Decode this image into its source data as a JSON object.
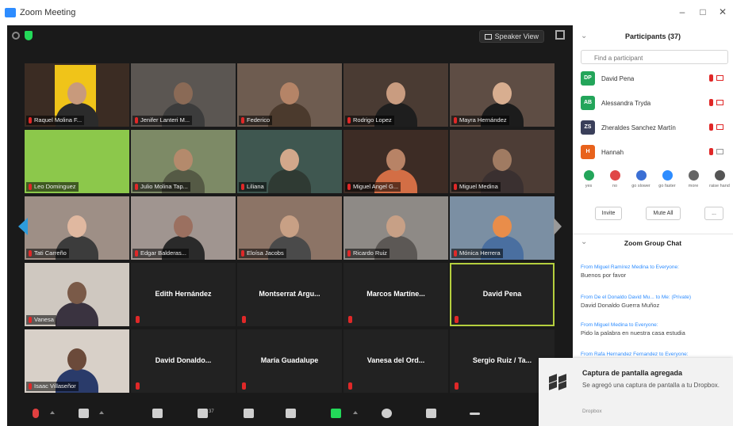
{
  "window": {
    "title": "Zoom Meeting",
    "controls": [
      "–",
      "□",
      "✕"
    ]
  },
  "meeting": {
    "speaker_view_label": "Speaker View",
    "tiles": [
      {
        "name": "Raquel Molina F...",
        "type": "video",
        "bg": "#3b2c23",
        "face": "#c89a7c",
        "shirt": "#2b2b2b",
        "accent": "#f0c419"
      },
      {
        "name": "Jenifer Lanteri M...",
        "type": "video",
        "bg": "#5b5652",
        "face": "#8a6a56",
        "shirt": "#3c3c3c",
        "accent": ""
      },
      {
        "name": "Federico",
        "type": "video",
        "bg": "#6e5c50",
        "face": "#b58467",
        "shirt": "#4b3a2d",
        "accent": ""
      },
      {
        "name": "Rodrigo Lopez",
        "type": "video",
        "bg": "#4a3b33",
        "face": "#c99c80",
        "shirt": "#1e1e1e",
        "accent": ""
      },
      {
        "name": "Mayra Hernández",
        "type": "video",
        "bg": "#5e4d44",
        "face": "#d8ae90",
        "shirt": "#1c1c1c",
        "accent": ""
      },
      {
        "name": "Leo Dominguez",
        "type": "video",
        "bg": "#8cc84b",
        "face": "",
        "shirt": "",
        "accent": ""
      },
      {
        "name": "Julio Molina Tap...",
        "type": "video",
        "bg": "#7d8a66",
        "face": "#b48a6c",
        "shirt": "#555a45",
        "accent": ""
      },
      {
        "name": "Liliana",
        "type": "video",
        "bg": "#3f5750",
        "face": "#d2a88b",
        "shirt": "#2f3a33",
        "accent": ""
      },
      {
        "name": "Miguel Angel G...",
        "type": "video",
        "bg": "#3d2c25",
        "face": "#b88366",
        "shirt": "#d36e45",
        "accent": ""
      },
      {
        "name": "Miguel Medina",
        "type": "video",
        "bg": "#4d3d36",
        "face": "#a07b62",
        "shirt": "#3a3030",
        "accent": ""
      },
      {
        "name": "Tati Carreño",
        "type": "video",
        "bg": "#9e8f86",
        "face": "#e0b8a0",
        "shirt": "#3c3c3c",
        "accent": ""
      },
      {
        "name": "Edgar Balderas...",
        "type": "video",
        "bg": "#a09590",
        "face": "#9b7060",
        "shirt": "#2a2a2a",
        "accent": ""
      },
      {
        "name": "Eloísa Jacobs",
        "type": "video",
        "bg": "#8c7466",
        "face": "#c8a085",
        "shirt": "#4a4a4a",
        "accent": ""
      },
      {
        "name": "Ricardo Ruiz",
        "type": "video",
        "bg": "#8e8a86",
        "face": "#c7a086",
        "shirt": "#5c5855",
        "accent": ""
      },
      {
        "name": "Mónica Herrera",
        "type": "video",
        "bg": "#7b8fa3",
        "face": "#e98d4a",
        "shirt": "#4a6fa0",
        "accent": ""
      },
      {
        "name": "Vanesa",
        "type": "video",
        "bg": "#cfc8c0",
        "face": "#7a5a48",
        "shirt": "#3a3340",
        "accent": ""
      },
      {
        "name": "Edith Hernández",
        "type": "name"
      },
      {
        "name": "Montserrat Argu...",
        "type": "name"
      },
      {
        "name": "Marcos Martíne...",
        "type": "name"
      },
      {
        "name": "David Pena",
        "type": "name",
        "active": true
      },
      {
        "name": "Isaac Villaseñor",
        "type": "video",
        "bg": "#d8d0c8",
        "face": "#6b4a3a",
        "shirt": "#2a3b6a",
        "accent": ""
      },
      {
        "name": "David Donaldo...",
        "type": "name"
      },
      {
        "name": "María Guadalupe",
        "type": "name"
      },
      {
        "name": "Vanesa del Ord...",
        "type": "name"
      },
      {
        "name": "Sergio Ruiz / Ta...",
        "type": "name"
      }
    ]
  },
  "toolbar": {
    "participant_count": "37",
    "items": [
      "unmute",
      "video",
      "security",
      "participants",
      "polls",
      "chat",
      "share",
      "record",
      "reactions",
      "more"
    ]
  },
  "panel": {
    "title": "Participants (37)",
    "search_placeholder": "Find a participant",
    "participants": [
      {
        "name": "David Pena",
        "initials": "DP",
        "color": "#23a55a"
      },
      {
        "name": "Alessandra Tryda",
        "initials": "AB",
        "color": "#23a55a"
      },
      {
        "name": "Zheraldes Sanchez Martín",
        "initials": "ZS",
        "color": "#3a3f5a"
      },
      {
        "name": "Hannah",
        "initials": "H",
        "color": "#e8621c"
      }
    ],
    "reactions": [
      {
        "label": "yes",
        "color": "#23a55a"
      },
      {
        "label": "no",
        "color": "#e04848"
      },
      {
        "label": "go slower",
        "color": "#3b6fd4"
      },
      {
        "label": "go faster",
        "color": "#2d8cff"
      },
      {
        "label": "more",
        "color": "#666666"
      },
      {
        "label": "raise hand",
        "color": "#555555"
      }
    ],
    "invite_label": "Invite",
    "mute_all_label": "Mute All",
    "more_label": "...",
    "chat_title": "Zoom Group Chat",
    "messages": [
      {
        "from": "From Miguel Ramírez Medina to Everyone:",
        "text": "Buenos por favor"
      },
      {
        "from": "From De el Donaldo David Mu... to Me: (Private)",
        "text": "David Donaldo Guerra Muñoz"
      },
      {
        "from": "From Miguel Medina to Everyone:",
        "text": "Pido la palabra en nuestra casa estudia"
      },
      {
        "from": "From Rafa Hernandez Fernandez to Everyone:",
        "text": ""
      }
    ]
  },
  "toast": {
    "title": "Captura de pantalla agregada",
    "body": "Se agregó una captura de pantalla a tu Dropbox.",
    "source": "Dropbox"
  }
}
